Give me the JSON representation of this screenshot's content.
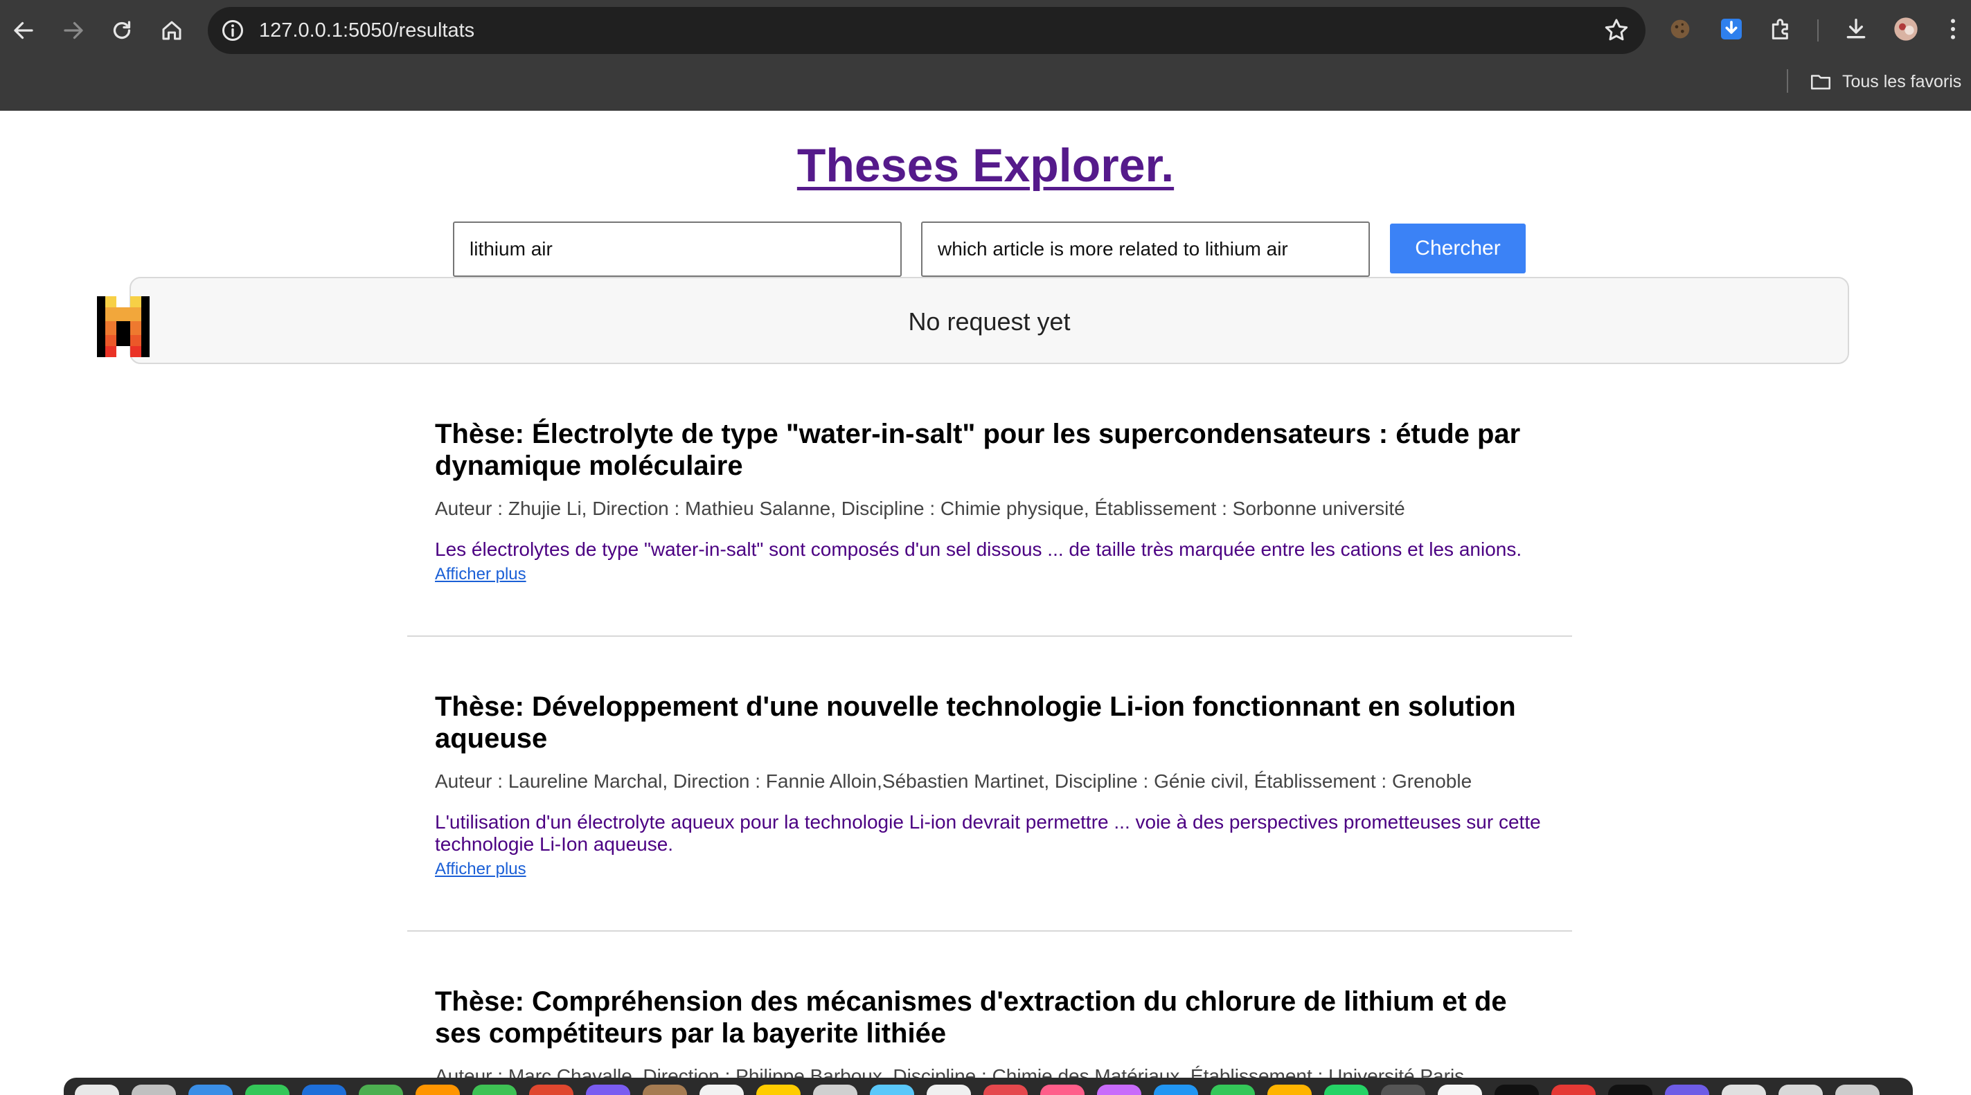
{
  "browser": {
    "url": "127.0.0.1:5050/resultats",
    "bookmarks_label": "Tous les favoris"
  },
  "page": {
    "site_title": "Theses Explorer.",
    "search": {
      "query_value": "lithium air",
      "question_value": "which article is more related to lithium air",
      "button_label": "Chercher"
    },
    "answer_text": "No request yet",
    "results": [
      {
        "title": "Thèse: Électrolyte de type \"water-in-salt\" pour les supercondensateurs : étude par dynamique moléculaire",
        "meta": "Auteur : Zhujie Li, Direction : Mathieu Salanne, Discipline : Chimie physique, Établissement : Sorbonne université",
        "abstract": "Les électrolytes de type \"water-in-salt\" sont composés d'un sel dissous ... de taille très marquée entre les cations et les anions.",
        "more_label": "Afficher plus"
      },
      {
        "title": "Thèse: Développement d'une nouvelle technologie Li-ion fonctionnant en solution aqueuse",
        "meta": "Auteur : Laureline Marchal, Direction : Fannie Alloin,Sébastien Martinet, Discipline : Génie civil, Établissement : Grenoble",
        "abstract": "L'utilisation d'un électrolyte aqueux pour la technologie Li-ion devrait permettre ... voie à des perspectives prometteuses sur cette technologie Li-Ion aqueuse.",
        "more_label": "Afficher plus"
      },
      {
        "title": "Thèse: Compréhension des mécanismes d'extraction du chlorure de lithium et de ses compétiteurs par la bayerite lithiée",
        "meta": "Auteur : Marc Chavalle, Direction : Philippe Barboux, Discipline : Chimie des Matériaux, Établissement : Université Paris"
      }
    ]
  },
  "icons": {
    "back": "arrow-left-icon",
    "forward": "arrow-right-icon",
    "reload": "reload-icon",
    "home": "home-icon",
    "site_info": "info-icon",
    "bookmark_star": "star-icon",
    "extensions": "puzzle-icon",
    "downloads": "download-icon",
    "menu": "kebab-menu-icon",
    "folder": "folder-icon"
  },
  "colors": {
    "chrome_bg": "#3a3a3a",
    "omnibox_bg": "#202020",
    "title_link": "#551a8b",
    "abstract_text": "#4b0082",
    "button_bg": "#3b82f6",
    "more_link": "#1a5fd6"
  },
  "dock": {
    "app_colors": [
      "#e8e8e8",
      "#c0c0c0",
      "#3a8ee6",
      "#34c759",
      "#1e6fd9",
      "#4caf50",
      "#ff9500",
      "#3ec254",
      "#e0472f",
      "#7a5cf0",
      "#a67c52",
      "#f2f2f2",
      "#ffcc00",
      "#d0d0d0",
      "#5ac8fa",
      "#f0f0f0",
      "#e5484d",
      "#ff5e8a",
      "#c86bfa",
      "#2196f3",
      "#34c759",
      "#ffb400",
      "#25d366",
      "#555555",
      "#f5f5f5",
      "#111111",
      "#e53935",
      "#111111",
      "#6e5ce6",
      "#e0e0e0",
      "#d8d8d8",
      "#cccccc"
    ]
  }
}
